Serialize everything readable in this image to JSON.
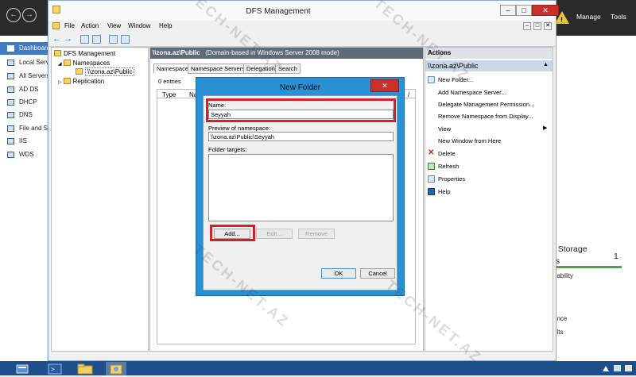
{
  "server_manager": {
    "nav_items": [
      {
        "label": "Dashboard",
        "active": true
      },
      {
        "label": "Local Server",
        "active": false
      },
      {
        "label": "All Servers",
        "active": false
      },
      {
        "label": "AD DS",
        "active": false
      },
      {
        "label": "DHCP",
        "active": false
      },
      {
        "label": "DNS",
        "active": false
      },
      {
        "label": "File and Storage Services",
        "active": false
      },
      {
        "label": "IIS",
        "active": false
      },
      {
        "label": "WDS",
        "active": false
      }
    ],
    "manage_label": "Manage",
    "tools_label": "Tools",
    "tile": {
      "title": "d Storage",
      "subtitle": "es",
      "count": "1",
      "rows": [
        "eability",
        "",
        "ance",
        "ults"
      ]
    }
  },
  "dfs_window": {
    "title": "DFS Management",
    "menu": [
      "File",
      "Action",
      "View",
      "Window",
      "Help"
    ],
    "tree": {
      "root": "DFS Management",
      "namespaces": "Namespaces",
      "namespace_item": "\\\\zona.az\\Public",
      "replication": "Replication"
    },
    "middle": {
      "header_path": "\\\\zona.az\\Public",
      "header_note": "(Domain-based in Windows Server 2008 mode)",
      "tabs": [
        "Namespace",
        "Namespace Servers",
        "Delegation",
        "Search"
      ],
      "active_tab": "Namespace",
      "entries": "0 entries",
      "columns": [
        "Type",
        "Na"
      ]
    },
    "actions": {
      "header": "Actions",
      "section": "\\\\zona.az\\Public",
      "items": [
        "New Folder...",
        "Add Namespace Server...",
        "Delegate Management Permission...",
        "Remove Namespace from Display...",
        "View",
        "New Window from Here",
        "Delete",
        "Refresh",
        "Properties",
        "Help"
      ]
    }
  },
  "dialog": {
    "title": "New Folder",
    "name_label": "Name:",
    "name_value": "Seyyah",
    "preview_label": "Preview of namespace:",
    "preview_value": "\\\\zona.az\\Public\\Seyyah",
    "targets_label": "Folder targets:",
    "add_label": "Add...",
    "edit_label": "Edit...",
    "remove_label": "Remove",
    "ok_label": "OK",
    "cancel_label": "Cancel"
  },
  "watermark": {
    "text_a": "TECH-NET",
    "text_b": ".AZ"
  },
  "colors": {
    "highlight": "#d4202a",
    "dialog_frame": "#2b8fd3",
    "nav_active": "#3e7bc0",
    "taskbar": "#1f4f8a"
  }
}
